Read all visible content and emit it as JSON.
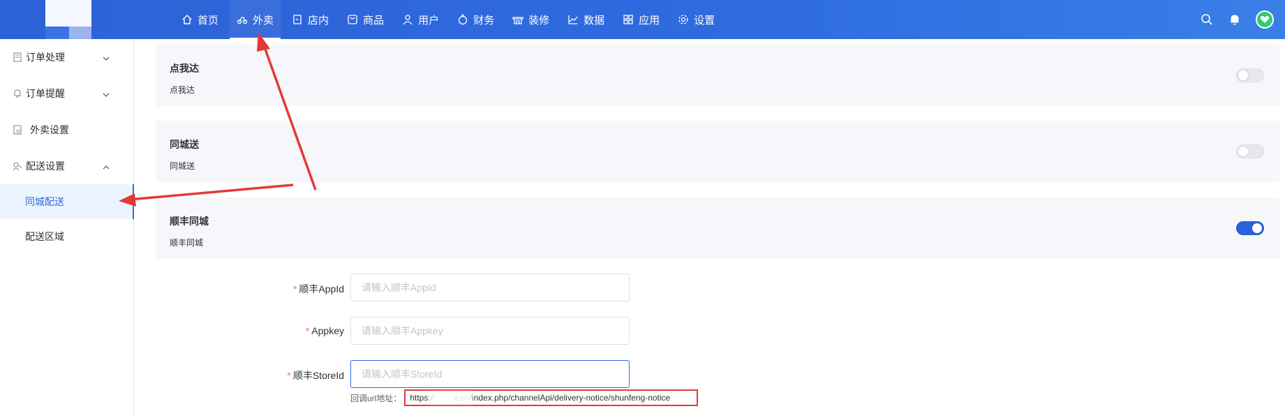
{
  "header": {
    "nav": [
      {
        "label": "首页",
        "icon": "home-icon"
      },
      {
        "label": "外卖",
        "icon": "bike-icon"
      },
      {
        "label": "店内",
        "icon": "store-icon"
      },
      {
        "label": "商品",
        "icon": "goods-icon"
      },
      {
        "label": "用户",
        "icon": "user-icon"
      },
      {
        "label": "财务",
        "icon": "wallet-icon"
      },
      {
        "label": "装修",
        "icon": "shop-icon"
      },
      {
        "label": "数据",
        "icon": "chart-icon"
      },
      {
        "label": "应用",
        "icon": "apps-icon"
      },
      {
        "label": "设置",
        "icon": "gear-icon"
      }
    ],
    "active_nav": "外卖",
    "right_icons": [
      "search-icon",
      "bell-icon",
      "avatar-icon"
    ]
  },
  "sidebar": {
    "items": [
      {
        "label": "订单处理",
        "icon": "order-icon",
        "expandable": true
      },
      {
        "label": "订单提醒",
        "icon": "bell-icon",
        "expandable": true
      },
      {
        "label": "外卖设置",
        "icon": "settings-doc-icon",
        "expandable": false
      },
      {
        "label": "配送设置",
        "icon": "delivery-icon",
        "expandable": true,
        "expanded": true
      }
    ],
    "sub_items": [
      {
        "label": "同城配送",
        "active": true
      },
      {
        "label": "配送区域",
        "active": false
      }
    ]
  },
  "main": {
    "cards": [
      {
        "title": "点我达",
        "subtitle": "点我达",
        "enabled": false
      },
      {
        "title": "同城送",
        "subtitle": "同城送",
        "enabled": false
      },
      {
        "title": "顺丰同城",
        "subtitle": "顺丰同城",
        "enabled": true
      }
    ],
    "form": {
      "appid_label": "顺丰AppId",
      "appid_placeholder": "请输入顺丰AppId",
      "appkey_label": "Appkey",
      "appkey_placeholder": "请输入顺丰Appkey",
      "storeid_label": "顺丰StoreId",
      "storeid_placeholder": "请输入顺丰StoreId",
      "callback_label": "回调url地址：",
      "callback_url": "https://        e.cn/index.php/channelApi/delivery-notice/shunfeng-notice"
    }
  },
  "colors": {
    "brand": "#2d62d6",
    "active": "#2d6be0",
    "annotation": "#e53935"
  }
}
